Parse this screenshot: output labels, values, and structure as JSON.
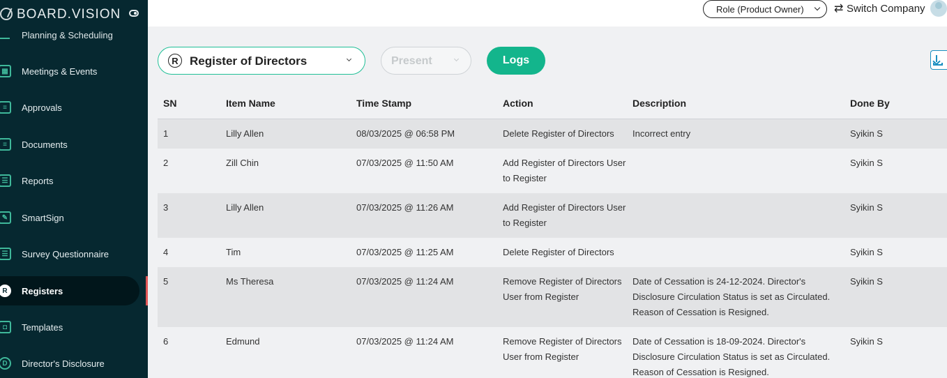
{
  "brand": {
    "name": "BOARD.VISION"
  },
  "sidebar": {
    "cut_item": "Planning & Scheduling",
    "items": [
      {
        "label": "Meetings & Events",
        "icon": "calendar-check-icon",
        "glyph": "▦"
      },
      {
        "label": "Approvals",
        "icon": "approval-doc-icon",
        "glyph": "≡"
      },
      {
        "label": "Documents",
        "icon": "documents-icon",
        "glyph": "≡"
      },
      {
        "label": "Reports",
        "icon": "reports-icon",
        "glyph": "☰"
      },
      {
        "label": "SmartSign",
        "icon": "pen-sign-icon",
        "glyph": "✎"
      },
      {
        "label": "Survey Questionnaire",
        "icon": "survey-list-icon",
        "glyph": "☰"
      },
      {
        "label": "Registers",
        "icon": "registers-r-icon",
        "glyph": "R",
        "active": true
      },
      {
        "label": "Templates",
        "icon": "templates-icon",
        "glyph": "◘"
      },
      {
        "label": "Director's Disclosure",
        "icon": "disclosure-d-icon",
        "glyph": "D"
      }
    ]
  },
  "topbar": {
    "role_label": "Role (Product Owner)",
    "switch_label": "Switch Company",
    "switch_glyph": "⇄"
  },
  "filters": {
    "register_glyph": "R",
    "register_label": "Register of Directors",
    "period_label": "Present",
    "logs_label": "Logs"
  },
  "table": {
    "headers": [
      "SN",
      "Item Name",
      "Time Stamp",
      "Action",
      "Description",
      "Done By"
    ],
    "rows": [
      {
        "sn": "1",
        "item": "Lilly Allen",
        "time": "08/03/2025 @ 06:58 PM",
        "action": "Delete Register of Directors",
        "description": "Incorrect entry",
        "done_by": "Syikin S"
      },
      {
        "sn": "2",
        "item": "Zill Chin",
        "time": "07/03/2025 @ 11:50 AM",
        "action": "Add Register of Directors User to Register",
        "description": "",
        "done_by": "Syikin S"
      },
      {
        "sn": "3",
        "item": "Lilly Allen",
        "time": "07/03/2025 @ 11:26 AM",
        "action": "Add Register of Directors User to Register",
        "description": "",
        "done_by": "Syikin S"
      },
      {
        "sn": "4",
        "item": "Tim",
        "time": "07/03/2025 @ 11:25 AM",
        "action": "Delete Register of Directors",
        "description": "",
        "done_by": "Syikin S"
      },
      {
        "sn": "5",
        "item": "Ms Theresa",
        "time": "07/03/2025 @ 11:24 AM",
        "action": "Remove Register of Directors User from Register",
        "description": "Date of Cessation is 24-12-2024. Director's Disclosure Circulation Status is set as Circulated. Reason of Cessation is Resigned.",
        "done_by": "Syikin S"
      },
      {
        "sn": "6",
        "item": "Edmund",
        "time": "07/03/2025 @ 11:24 AM",
        "action": "Remove Register of Directors User from Register",
        "description": "Date of Cessation is 18-09-2024. Director's Disclosure Circulation Status is set as Circulated. Reason of Cessation is Resigned.",
        "done_by": "Syikin S"
      }
    ]
  },
  "colors": {
    "sidebar_bg": "#062830",
    "accent": "#13b58c",
    "active_marker": "#e25757"
  }
}
